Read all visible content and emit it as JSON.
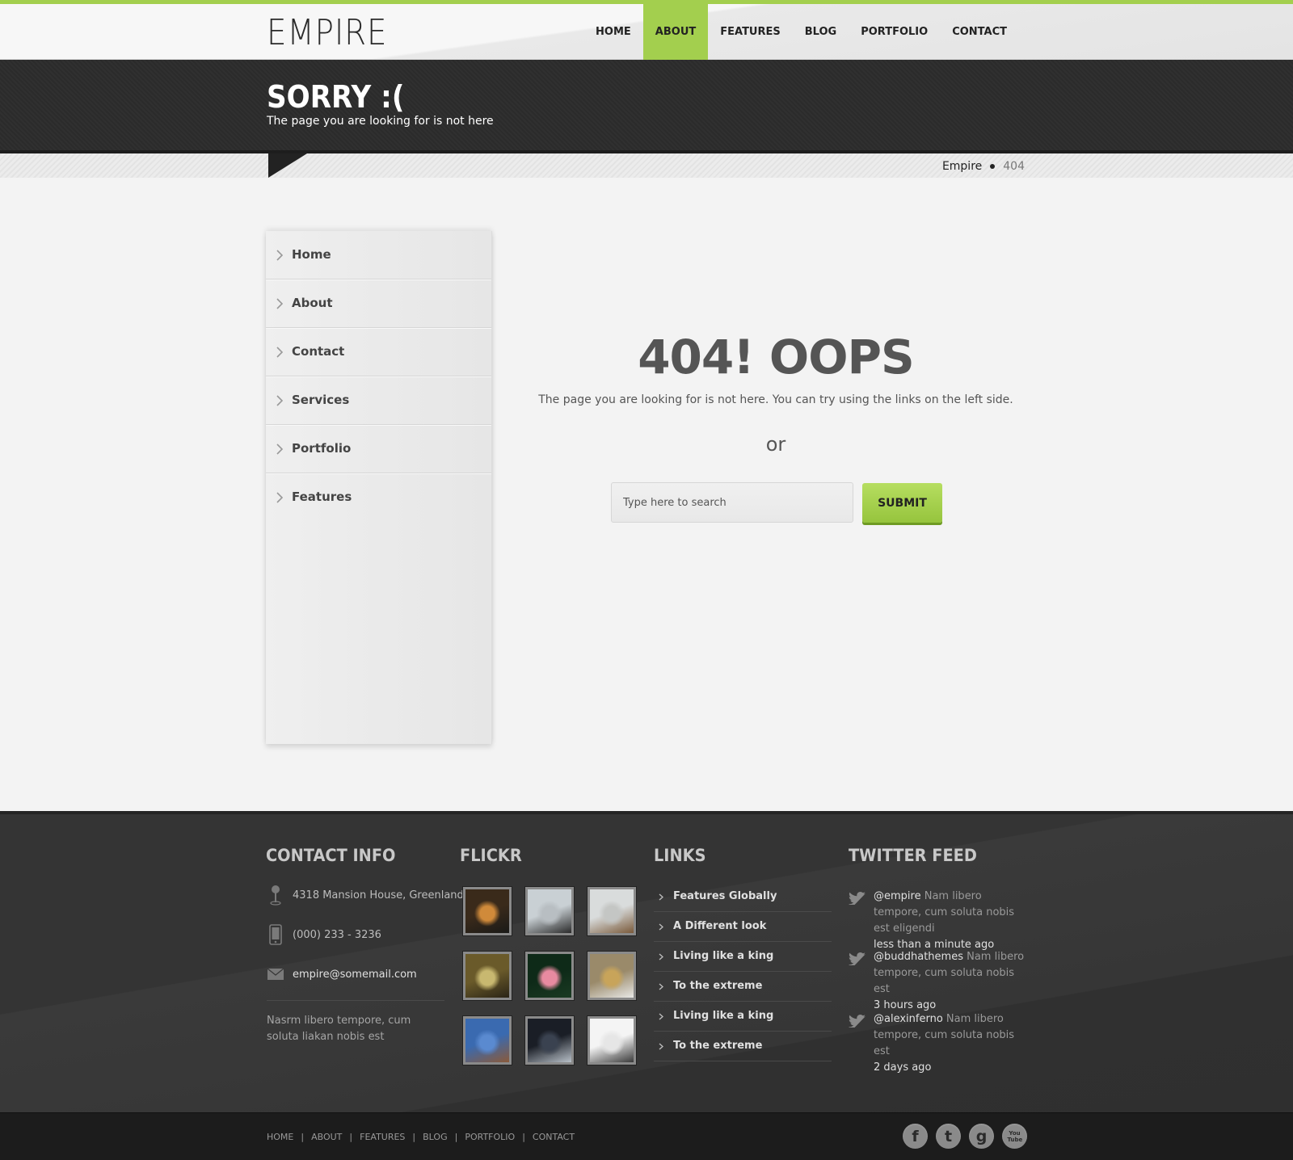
{
  "header": {
    "logo": "EMPIRE",
    "nav": [
      {
        "label": "HOME",
        "active": false
      },
      {
        "label": "ABOUT",
        "active": true
      },
      {
        "label": "FEATURES",
        "active": false
      },
      {
        "label": "BLOG",
        "active": false
      },
      {
        "label": "PORTFOLIO",
        "active": false
      },
      {
        "label": "CONTACT",
        "active": false
      }
    ]
  },
  "banner": {
    "title": "SORRY :(",
    "subtitle": "The page you are looking for is not here"
  },
  "breadcrumb": {
    "root": "Empire",
    "current": "404"
  },
  "sidebar": {
    "items": [
      {
        "label": "Home"
      },
      {
        "label": "About"
      },
      {
        "label": "Contact"
      },
      {
        "label": "Services"
      },
      {
        "label": "Portfolio"
      },
      {
        "label": "Features"
      }
    ]
  },
  "main": {
    "heading": "404! OOPS",
    "message": "The page you are looking for is not here. You can try using the links on the left side.",
    "or": "or",
    "search_placeholder": "Type here to search",
    "submit_label": "SUBMIT"
  },
  "footer": {
    "contact": {
      "heading": "CONTACT INFO",
      "address": "4318 Mansion House, Greenland",
      "phone": "(000) 233 - 3236",
      "email": "empire@somemail.com",
      "note": "Nasrm libero tempore, cum soluta liakan nobis est"
    },
    "flickr": {
      "heading": "FLICKR",
      "photos": [
        {
          "subject": "sunset-clouds",
          "colors": [
            "#3a2a1a",
            "#d08a3a",
            "#1a1a18"
          ]
        },
        {
          "subject": "bird-on-branch",
          "colors": [
            "#c9d0d4",
            "#b8bec2",
            "#2a2a2a"
          ]
        },
        {
          "subject": "deer-in-snow",
          "colors": [
            "#d9dcdc",
            "#c4c6c4",
            "#7a5a3a"
          ]
        },
        {
          "subject": "insect-macro",
          "colors": [
            "#6a5a2a",
            "#c8b870",
            "#2a2416"
          ]
        },
        {
          "subject": "pink-flower",
          "colors": [
            "#0e2a18",
            "#e88aa0",
            "#1a3a22"
          ]
        },
        {
          "subject": "leopard",
          "colors": [
            "#9a8a6a",
            "#c8a45a",
            "#e8e8e6"
          ]
        },
        {
          "subject": "bird-blue-sky",
          "colors": [
            "#3a6ab0",
            "#5a8ad0",
            "#8a5a3a"
          ]
        },
        {
          "subject": "starling",
          "colors": [
            "#1a1e26",
            "#3a4250",
            "#b8c0c8"
          ]
        },
        {
          "subject": "trees-in-snow",
          "colors": [
            "#f4f4f4",
            "#e6e6e6",
            "#3a3a3a"
          ]
        }
      ]
    },
    "links": {
      "heading": "LINKS",
      "items": [
        {
          "label": "Features Globally"
        },
        {
          "label": "A Different look"
        },
        {
          "label": "Living like a king"
        },
        {
          "label": "To the extreme"
        },
        {
          "label": "Living like a king"
        },
        {
          "label": "To the extreme"
        }
      ]
    },
    "twitter": {
      "heading": "TWITTER FEED",
      "tweets": [
        {
          "user": "@empire",
          "text": " Nam libero tempore, cum soluta nobis est eligendi",
          "time": "less than a minute ago"
        },
        {
          "user": "@buddhathemes",
          "text": " Nam libero tempore, cum soluta nobis est",
          "time": "3 hours ago"
        },
        {
          "user": "@alexinferno",
          "text": " Nam libero tempore, cum soluta nobis est",
          "time": "2 days ago"
        }
      ]
    }
  },
  "bottombar": {
    "nav": [
      "HOME",
      "ABOUT",
      "FEATURES",
      "BLOG",
      "PORTFOLIO",
      "CONTACT"
    ],
    "separator": "|",
    "social": [
      {
        "icon": "facebook-icon",
        "glyph": "f"
      },
      {
        "icon": "twitter-icon",
        "glyph": "t"
      },
      {
        "icon": "google-icon",
        "glyph": "g"
      },
      {
        "icon": "youtube-icon",
        "glyph": "You Tube"
      }
    ]
  },
  "colors": {
    "accent": "#a3cf4e",
    "dark": "#2b2b2b",
    "footer": "#343434"
  }
}
